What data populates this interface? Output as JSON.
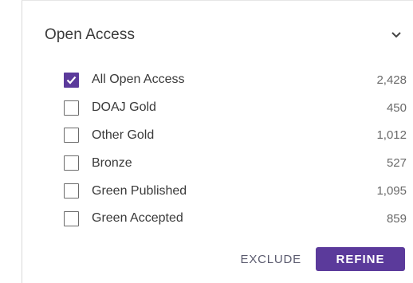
{
  "filter": {
    "title": "Open Access",
    "options": [
      {
        "label": "All Open Access",
        "count": "2,428",
        "checked": true
      },
      {
        "label": "DOAJ Gold",
        "count": "450",
        "checked": false
      },
      {
        "label": "Other Gold",
        "count": "1,012",
        "checked": false
      },
      {
        "label": "Bronze",
        "count": "527",
        "checked": false
      },
      {
        "label": "Green Published",
        "count": "1,095",
        "checked": false
      },
      {
        "label": "Green Accepted",
        "count": "859",
        "checked": false
      }
    ]
  },
  "actions": {
    "exclude_label": "EXCLUDE",
    "refine_label": "REFINE"
  },
  "colors": {
    "accent": "#5b3a9b"
  },
  "icons": {
    "collapse": "chevron-down-icon",
    "check": "checkmark-icon"
  }
}
